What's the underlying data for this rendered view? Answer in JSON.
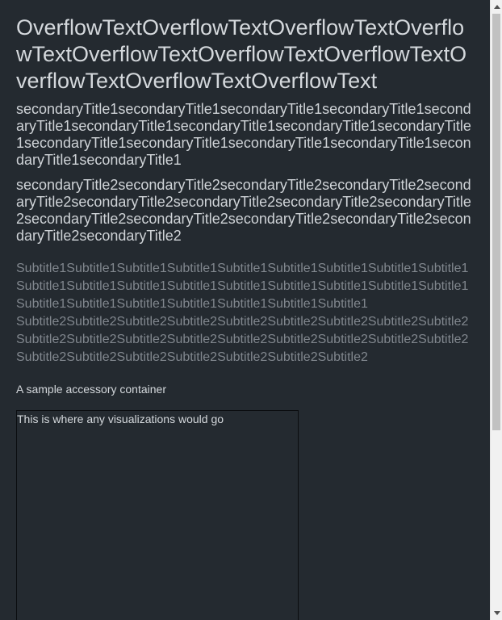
{
  "page": {
    "title": "OverflowTextOverflowTextOverflowTextOverflowTextOverflowTextOverflowTextOverflowTextOverflowTextOverflowTextOverflowText",
    "secondary_titles": [
      "secondaryTitle1secondaryTitle1secondaryTitle1secondaryTitle1secondaryTitle1secondaryTitle1secondaryTitle1secondaryTitle1secondaryTitle1secondaryTitle1secondaryTitle1secondaryTitle1secondaryTitle1secondaryTitle1secondaryTitle1",
      "secondaryTitle2secondaryTitle2secondaryTitle2secondaryTitle2secondaryTitle2secondaryTitle2secondaryTitle2secondaryTitle2secondaryTitle2secondaryTitle2secondaryTitle2secondaryTitle2secondaryTitle2secondaryTitle2secondaryTitle2"
    ],
    "subtitles": [
      "Subtitle1Subtitle1Subtitle1Subtitle1Subtitle1Subtitle1Subtitle1Subtitle1Subtitle1Subtitle1Subtitle1Subtitle1Subtitle1Subtitle1Subtitle1Subtitle1Subtitle1Subtitle1Subtitle1Subtitle1Subtitle1Subtitle1Subtitle1Subtitle1Subtitle1",
      "Subtitle2Subtitle2Subtitle2Subtitle2Subtitle2Subtitle2Subtitle2Subtitle2Subtitle2Subtitle2Subtitle2Subtitle2Subtitle2Subtitle2Subtitle2Subtitle2Subtitle2Subtitle2Subtitle2Subtitle2Subtitle2Subtitle2Subtitle2Subtitle2Subtitle2"
    ],
    "accessory_text": "A sample accessory container",
    "visualization_placeholder": "This is where any visualizations would go"
  },
  "colors": {
    "background": "#242a30",
    "title_text": "#d4d8dc",
    "subtitle_text": "#81878e",
    "scrollbar_track": "#f1f1f1",
    "scrollbar_thumb": "#c1c1c1"
  },
  "icons": {
    "scroll_up": "triangle-up-icon",
    "scroll_down": "triangle-down-icon"
  }
}
